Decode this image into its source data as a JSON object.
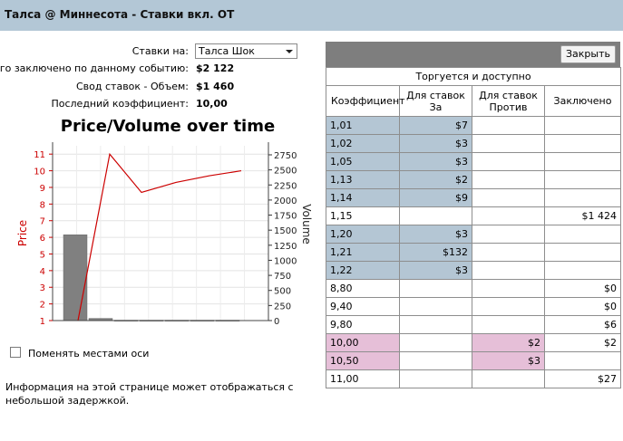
{
  "window": {
    "title": "Талса @ Миннесота - Ставки вкл. ОТ"
  },
  "info": {
    "bets_on_label": "Ставки на:",
    "bets_on_selected": "Талса Шок",
    "total_label": "Всего заключено по данному событию:",
    "total_value": "$2 122",
    "volume_label": "Свод ставок - Объем:",
    "volume_value": "$1 460",
    "last_odds_label": "Последний коэффициент:",
    "last_odds_value": "10,00"
  },
  "chart_data": {
    "type": "line",
    "title": "Price/Volume over time",
    "ylabel": "Price",
    "y2label": "Volume",
    "ylim": [
      1,
      11.5
    ],
    "y2lim": [
      0,
      2900
    ],
    "yticks": [
      "1",
      "2",
      "3",
      "4",
      "5",
      "6",
      "7",
      "8",
      "9",
      "10",
      "11"
    ],
    "y2ticks": [
      "0",
      "250",
      "500",
      "750",
      "1000",
      "1250",
      "1500",
      "1750",
      "2000",
      "2250",
      "2500",
      "2750"
    ],
    "price_series": {
      "color": "#cc0000",
      "values": [
        1.0,
        11.0,
        8.7,
        9.3,
        9.7,
        10.0
      ]
    },
    "volume_series": {
      "color": "#808080",
      "values": [
        1424,
        36,
        6,
        6,
        6,
        6,
        6
      ]
    }
  },
  "swap_axes_label": "Поменять местами оси",
  "notice": "Информация на этой странице может отображаться с небольшой задержкой.",
  "panel": {
    "close_label": "Закрыть",
    "caption": "Торгуется и доступно",
    "headers": [
      "Коэффициент",
      "Для ставок За",
      "Для ставок Против",
      "Заключено"
    ],
    "colors": {
      "back": "#b4c6d4",
      "lay": "#e6bfd8"
    },
    "rows": [
      {
        "odds": "1,01",
        "back": "$7",
        "lay": "",
        "matched": "",
        "side": "back"
      },
      {
        "odds": "1,02",
        "back": "$3",
        "lay": "",
        "matched": "",
        "side": "back"
      },
      {
        "odds": "1,05",
        "back": "$3",
        "lay": "",
        "matched": "",
        "side": "back"
      },
      {
        "odds": "1,13",
        "back": "$2",
        "lay": "",
        "matched": "",
        "side": "back"
      },
      {
        "odds": "1,14",
        "back": "$9",
        "lay": "",
        "matched": "",
        "side": "back"
      },
      {
        "odds": "1,15",
        "back": "",
        "lay": "",
        "matched": "$1 424",
        "side": ""
      },
      {
        "odds": "1,20",
        "back": "$3",
        "lay": "",
        "matched": "",
        "side": "back"
      },
      {
        "odds": "1,21",
        "back": "$132",
        "lay": "",
        "matched": "",
        "side": "back"
      },
      {
        "odds": "1,22",
        "back": "$3",
        "lay": "",
        "matched": "",
        "side": "back"
      },
      {
        "odds": "8,80",
        "back": "",
        "lay": "",
        "matched": "$0",
        "side": ""
      },
      {
        "odds": "9,40",
        "back": "",
        "lay": "",
        "matched": "$0",
        "side": ""
      },
      {
        "odds": "9,80",
        "back": "",
        "lay": "",
        "matched": "$6",
        "side": ""
      },
      {
        "odds": "10,00",
        "back": "",
        "lay": "$2",
        "matched": "$2",
        "side": "lay"
      },
      {
        "odds": "10,50",
        "back": "",
        "lay": "$3",
        "matched": "",
        "side": "lay"
      },
      {
        "odds": "11,00",
        "back": "",
        "lay": "",
        "matched": "$27",
        "side": ""
      }
    ]
  }
}
